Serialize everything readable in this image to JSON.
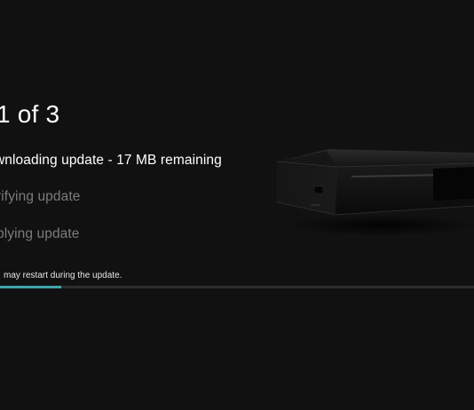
{
  "update": {
    "step_title": "1 of 3",
    "steps": [
      {
        "label": "wnloading update - 17 MB remaining",
        "state": "active"
      },
      {
        "label": "rifying update",
        "state": "pending"
      },
      {
        "label": "plying update",
        "state": "pending"
      }
    ],
    "note": "may restart during the update.",
    "progress": 0.13
  },
  "colors": {
    "background": "#111111",
    "active_text": "#ffffff",
    "pending_text": "#7c7c7c",
    "progress_accent": "#3fa5ac",
    "progress_track": "#2d2d2d"
  },
  "illustration": {
    "icon": "console-icon"
  }
}
